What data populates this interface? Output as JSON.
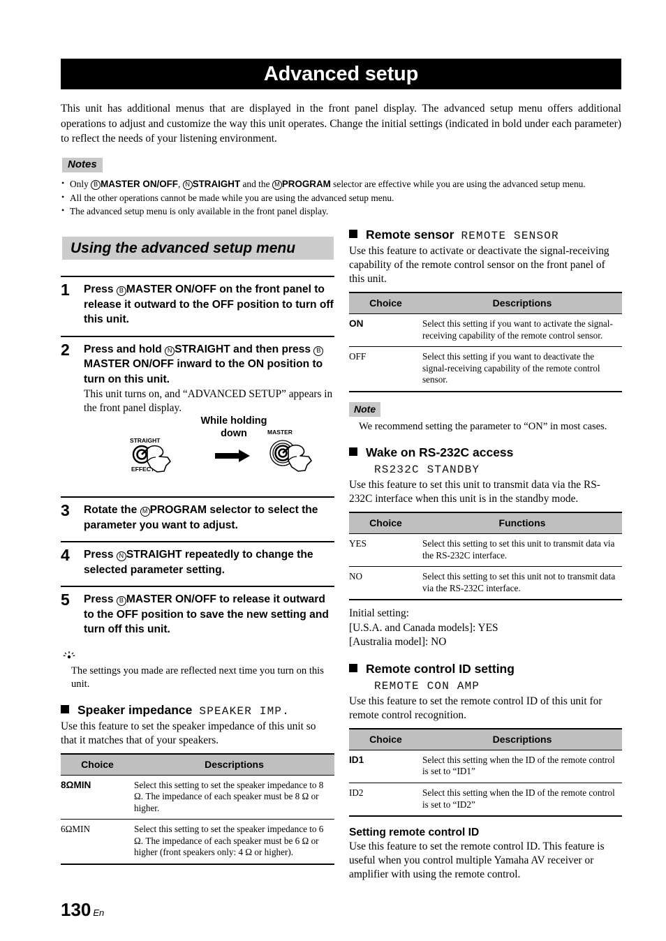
{
  "page": {
    "title": "Advanced setup",
    "number": "130",
    "language_code": "En",
    "intro": "This unit has additional menus that are displayed in the front panel display. The advanced setup menu offers additional operations to adjust and customize the way this unit operates. Change the initial settings (indicated in bold under each parameter) to reflect the needs of your listening environment."
  },
  "notes": {
    "label": "Notes",
    "items": [
      {
        "parts": [
          {
            "type": "text",
            "value": "Only "
          },
          {
            "type": "circled",
            "value": "B"
          },
          {
            "type": "bold",
            "value": "MASTER ON/OFF"
          },
          {
            "type": "text",
            "value": ", "
          },
          {
            "type": "circled",
            "value": "N"
          },
          {
            "type": "bold",
            "value": "STRAIGHT"
          },
          {
            "type": "text",
            "value": " and the "
          },
          {
            "type": "circled",
            "value": "M"
          },
          {
            "type": "bold",
            "value": "PROGRAM"
          },
          {
            "type": "text",
            "value": " selector are effective while you are using the advanced setup menu."
          }
        ]
      },
      {
        "parts": [
          {
            "type": "text",
            "value": "All the other operations cannot be made while you are using the advanced setup menu."
          }
        ]
      },
      {
        "parts": [
          {
            "type": "text",
            "value": "The advanced setup menu is only available in the front panel display."
          }
        ]
      }
    ]
  },
  "section": {
    "heading": "Using the advanced setup menu"
  },
  "steps": [
    {
      "number": "1",
      "title_parts": [
        {
          "type": "text",
          "value": "Press "
        },
        {
          "type": "circled",
          "value": "B"
        },
        {
          "type": "bold",
          "value": "MASTER ON/OFF"
        },
        {
          "type": "text",
          "value": " on the front panel to release it outward to the OFF position to turn off this unit."
        }
      ],
      "sub": ""
    },
    {
      "number": "2",
      "title_parts": [
        {
          "type": "text",
          "value": "Press and hold "
        },
        {
          "type": "circled",
          "value": "N"
        },
        {
          "type": "bold",
          "value": "STRAIGHT"
        },
        {
          "type": "text",
          "value": " and then press "
        },
        {
          "type": "circled",
          "value": "B"
        },
        {
          "type": "bold",
          "value": "MASTER ON/OFF"
        },
        {
          "type": "text",
          "value": " inward to the ON position to turn on this unit."
        }
      ],
      "sub": "This unit turns on, and “ADVANCED SETUP” appears in the front panel display."
    },
    {
      "number": "3",
      "title_parts": [
        {
          "type": "text",
          "value": "Rotate the "
        },
        {
          "type": "circled",
          "value": "M"
        },
        {
          "type": "bold",
          "value": "PROGRAM"
        },
        {
          "type": "text",
          "value": " selector to select the parameter you want to adjust."
        }
      ],
      "sub": ""
    },
    {
      "number": "4",
      "title_parts": [
        {
          "type": "text",
          "value": "Press "
        },
        {
          "type": "circled",
          "value": "N"
        },
        {
          "type": "bold",
          "value": "STRAIGHT"
        },
        {
          "type": "text",
          "value": " repeatedly to change the selected parameter setting."
        }
      ],
      "sub": ""
    },
    {
      "number": "5",
      "title_parts": [
        {
          "type": "text",
          "value": "Press "
        },
        {
          "type": "circled",
          "value": "B"
        },
        {
          "type": "bold",
          "value": "MASTER ON/OFF"
        },
        {
          "type": "text",
          "value": " to release it outward to the OFF position to save the new setting and turn off this unit."
        }
      ],
      "sub": ""
    }
  ],
  "figure": {
    "caption_line1": "While holding",
    "caption_line2": "down",
    "straight_label": "STRAIGHT",
    "effect_label": "EFFECT",
    "master_label": "MASTER"
  },
  "hint": {
    "text": "The settings you made are reflected next time you turn on this unit."
  },
  "speaker_impedance": {
    "name": "Speaker impedance",
    "code": "SPEAKER IMP.",
    "description": "Use this feature to set the speaker impedance of this unit so that it matches that of your speakers.",
    "table": {
      "headers": [
        "Choice",
        "Descriptions"
      ],
      "rows": [
        {
          "choice": "8ΩMIN",
          "bold": true,
          "description": "Select this setting to set the speaker impedance to 8 Ω. The impedance of each speaker must be 8 Ω or higher."
        },
        {
          "choice": "6ΩMIN",
          "bold": false,
          "description": "Select this setting to set the speaker impedance to 6 Ω. The impedance of each speaker must be 6 Ω or higher (front speakers only: 4 Ω or higher)."
        }
      ]
    }
  },
  "remote_sensor": {
    "name": "Remote sensor",
    "code": "REMOTE SENSOR",
    "description": "Use this feature to activate or deactivate the signal-receiving capability of the remote control sensor on the front panel of this unit.",
    "table": {
      "headers": [
        "Choice",
        "Descriptions"
      ],
      "rows": [
        {
          "choice": "ON",
          "bold": true,
          "description": "Select this setting if you want to activate the signal-receiving capability of the remote control sensor."
        },
        {
          "choice": "OFF",
          "bold": false,
          "description": "Select this setting if you want to deactivate the signal-receiving capability of the remote control sensor."
        }
      ]
    },
    "note": {
      "label": "Note",
      "text": "We recommend setting the parameter to “ON” in most cases."
    }
  },
  "wake_on_rs232c": {
    "name": "Wake on RS-232C access",
    "code": "RS232C STANDBY",
    "description": "Use this feature to set this unit to transmit data via the RS-232C interface when this unit is in the standby mode.",
    "table": {
      "headers": [
        "Choice",
        "Functions"
      ],
      "rows": [
        {
          "choice": "YES",
          "bold": false,
          "description": "Select this setting to set this unit to transmit data via the RS-232C interface."
        },
        {
          "choice": "NO",
          "bold": false,
          "description": "Select this setting to set this unit not to transmit data via the RS-232C interface."
        }
      ]
    },
    "initial_setting_lines": [
      "Initial setting:",
      "[U.S.A. and Canada models]: YES",
      "[Australia model]: NO"
    ]
  },
  "remote_control_id": {
    "name": "Remote control ID setting",
    "code": "REMOTE CON AMP",
    "description": "Use this feature to set the remote control ID of this unit for remote control recognition.",
    "table": {
      "headers": [
        "Choice",
        "Descriptions"
      ],
      "rows": [
        {
          "choice": "ID1",
          "bold": true,
          "description": "Select this setting when the ID of the remote control is set to “ID1”"
        },
        {
          "choice": "ID2",
          "bold": false,
          "description": "Select this setting when the ID of the remote control is set to “ID2”"
        }
      ]
    },
    "sub_heading": "Setting remote control ID",
    "sub_text": "Use this feature to set the remote control ID. This feature is useful when you control multiple Yamaha AV receiver or amplifier with using the remote control."
  }
}
